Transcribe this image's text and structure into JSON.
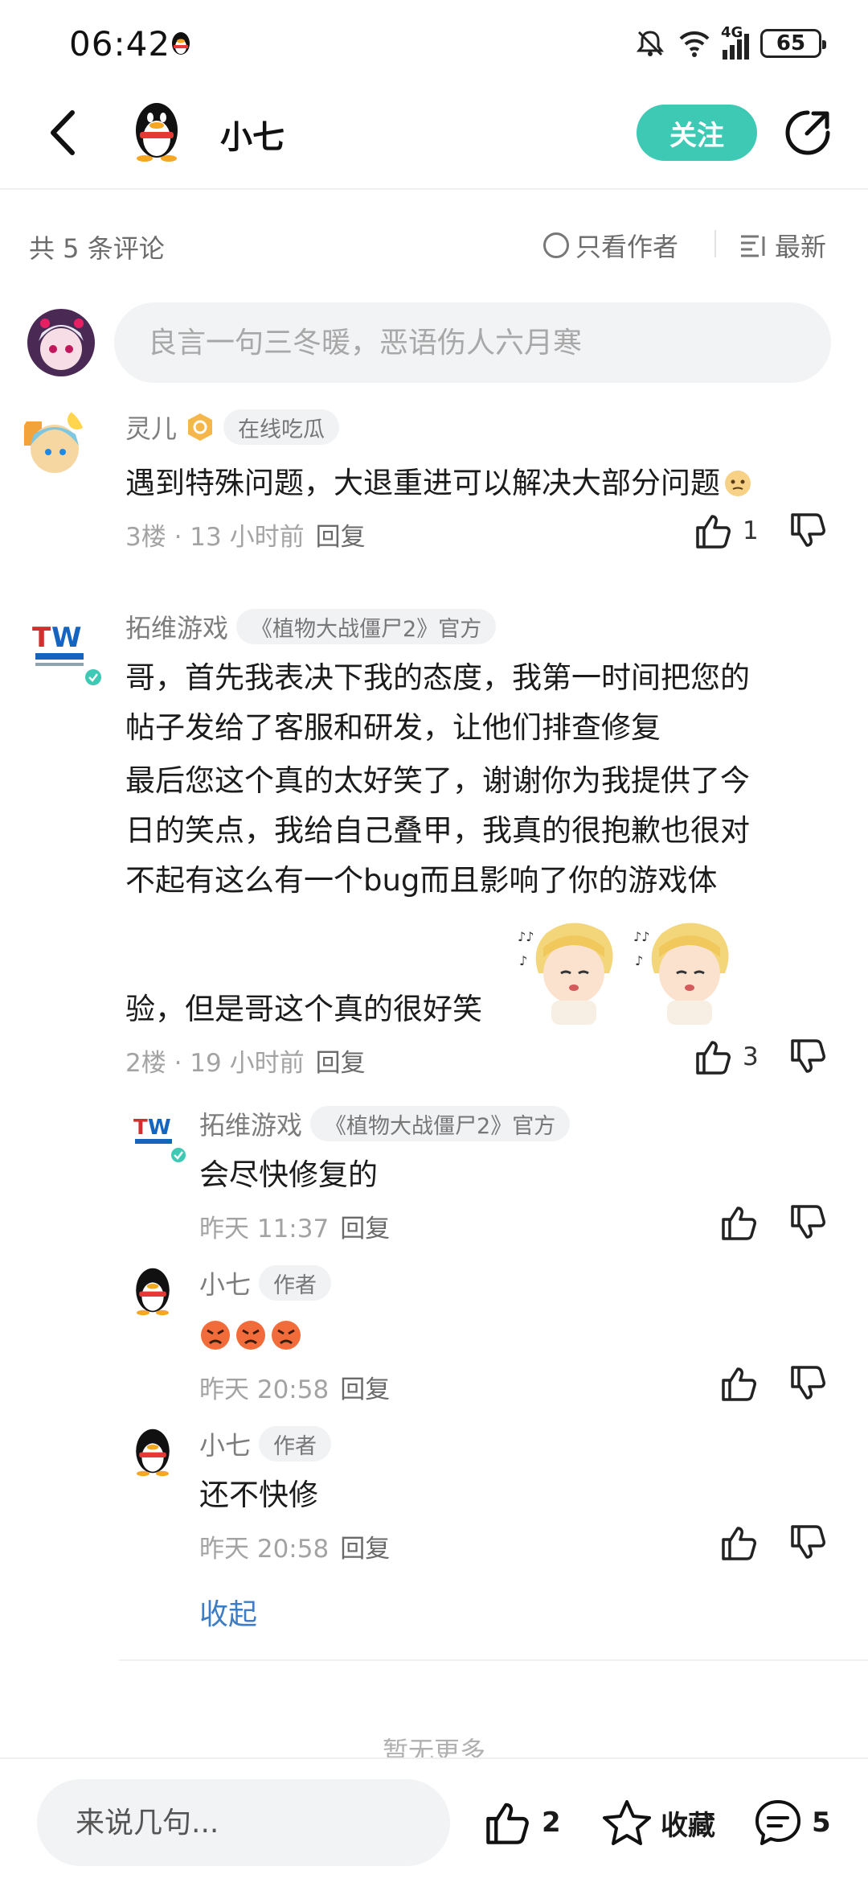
{
  "status_bar": {
    "time": "06:42",
    "battery": "65",
    "network": "4G"
  },
  "header": {
    "name": "小七",
    "follow_label": "关注"
  },
  "toolbar": {
    "count_text": "共 5 条评论",
    "only_author": "只看作者",
    "sort": "最新"
  },
  "input": {
    "placeholder": "良言一句三冬暖，恶语伤人六月寒"
  },
  "comments": [
    {
      "name": "灵儿",
      "tag": "在线吃瓜",
      "text": "遇到特殊问题，大退重进可以解决大部分问题",
      "floor": "3楼",
      "time": "13 小时前",
      "reply": "回复",
      "likes": "1"
    },
    {
      "name": "拓维游戏",
      "tag": "《植物大战僵尸2》官方",
      "lines": [
        "哥，首先我表决下我的态度，我第一时间把您的",
        "帖子发给了客服和研发，让他们排查修复",
        "最后您这个真的太好笑了，谢谢你为我提供了今",
        "日的笑点，我给自己叠甲，我真的很抱歉也很对",
        "不起有这么有一个bug而且影响了你的游戏体",
        "验，但是哥这个真的很好笑"
      ],
      "floor": "2楼",
      "time": "19 小时前",
      "reply": "回复",
      "likes": "3",
      "replies": [
        {
          "name": "拓维游戏",
          "tag": "《植物大战僵尸2》官方",
          "text": "会尽快修复的",
          "time": "昨天 11:37",
          "reply": "回复"
        },
        {
          "name": "小七",
          "tag": "作者",
          "text": "",
          "time": "昨天 20:58",
          "reply": "回复"
        },
        {
          "name": "小七",
          "tag": "作者",
          "text": "还不快修",
          "time": "昨天 20:58",
          "reply": "回复"
        }
      ]
    }
  ],
  "collapse": "收起",
  "no_more": "暂无更多",
  "bottom": {
    "placeholder": "来说几句...",
    "likes": "2",
    "favorite": "收藏",
    "comments": "5"
  },
  "colors": {
    "accent": "#3ec9b5",
    "link": "#3e7cc4"
  }
}
